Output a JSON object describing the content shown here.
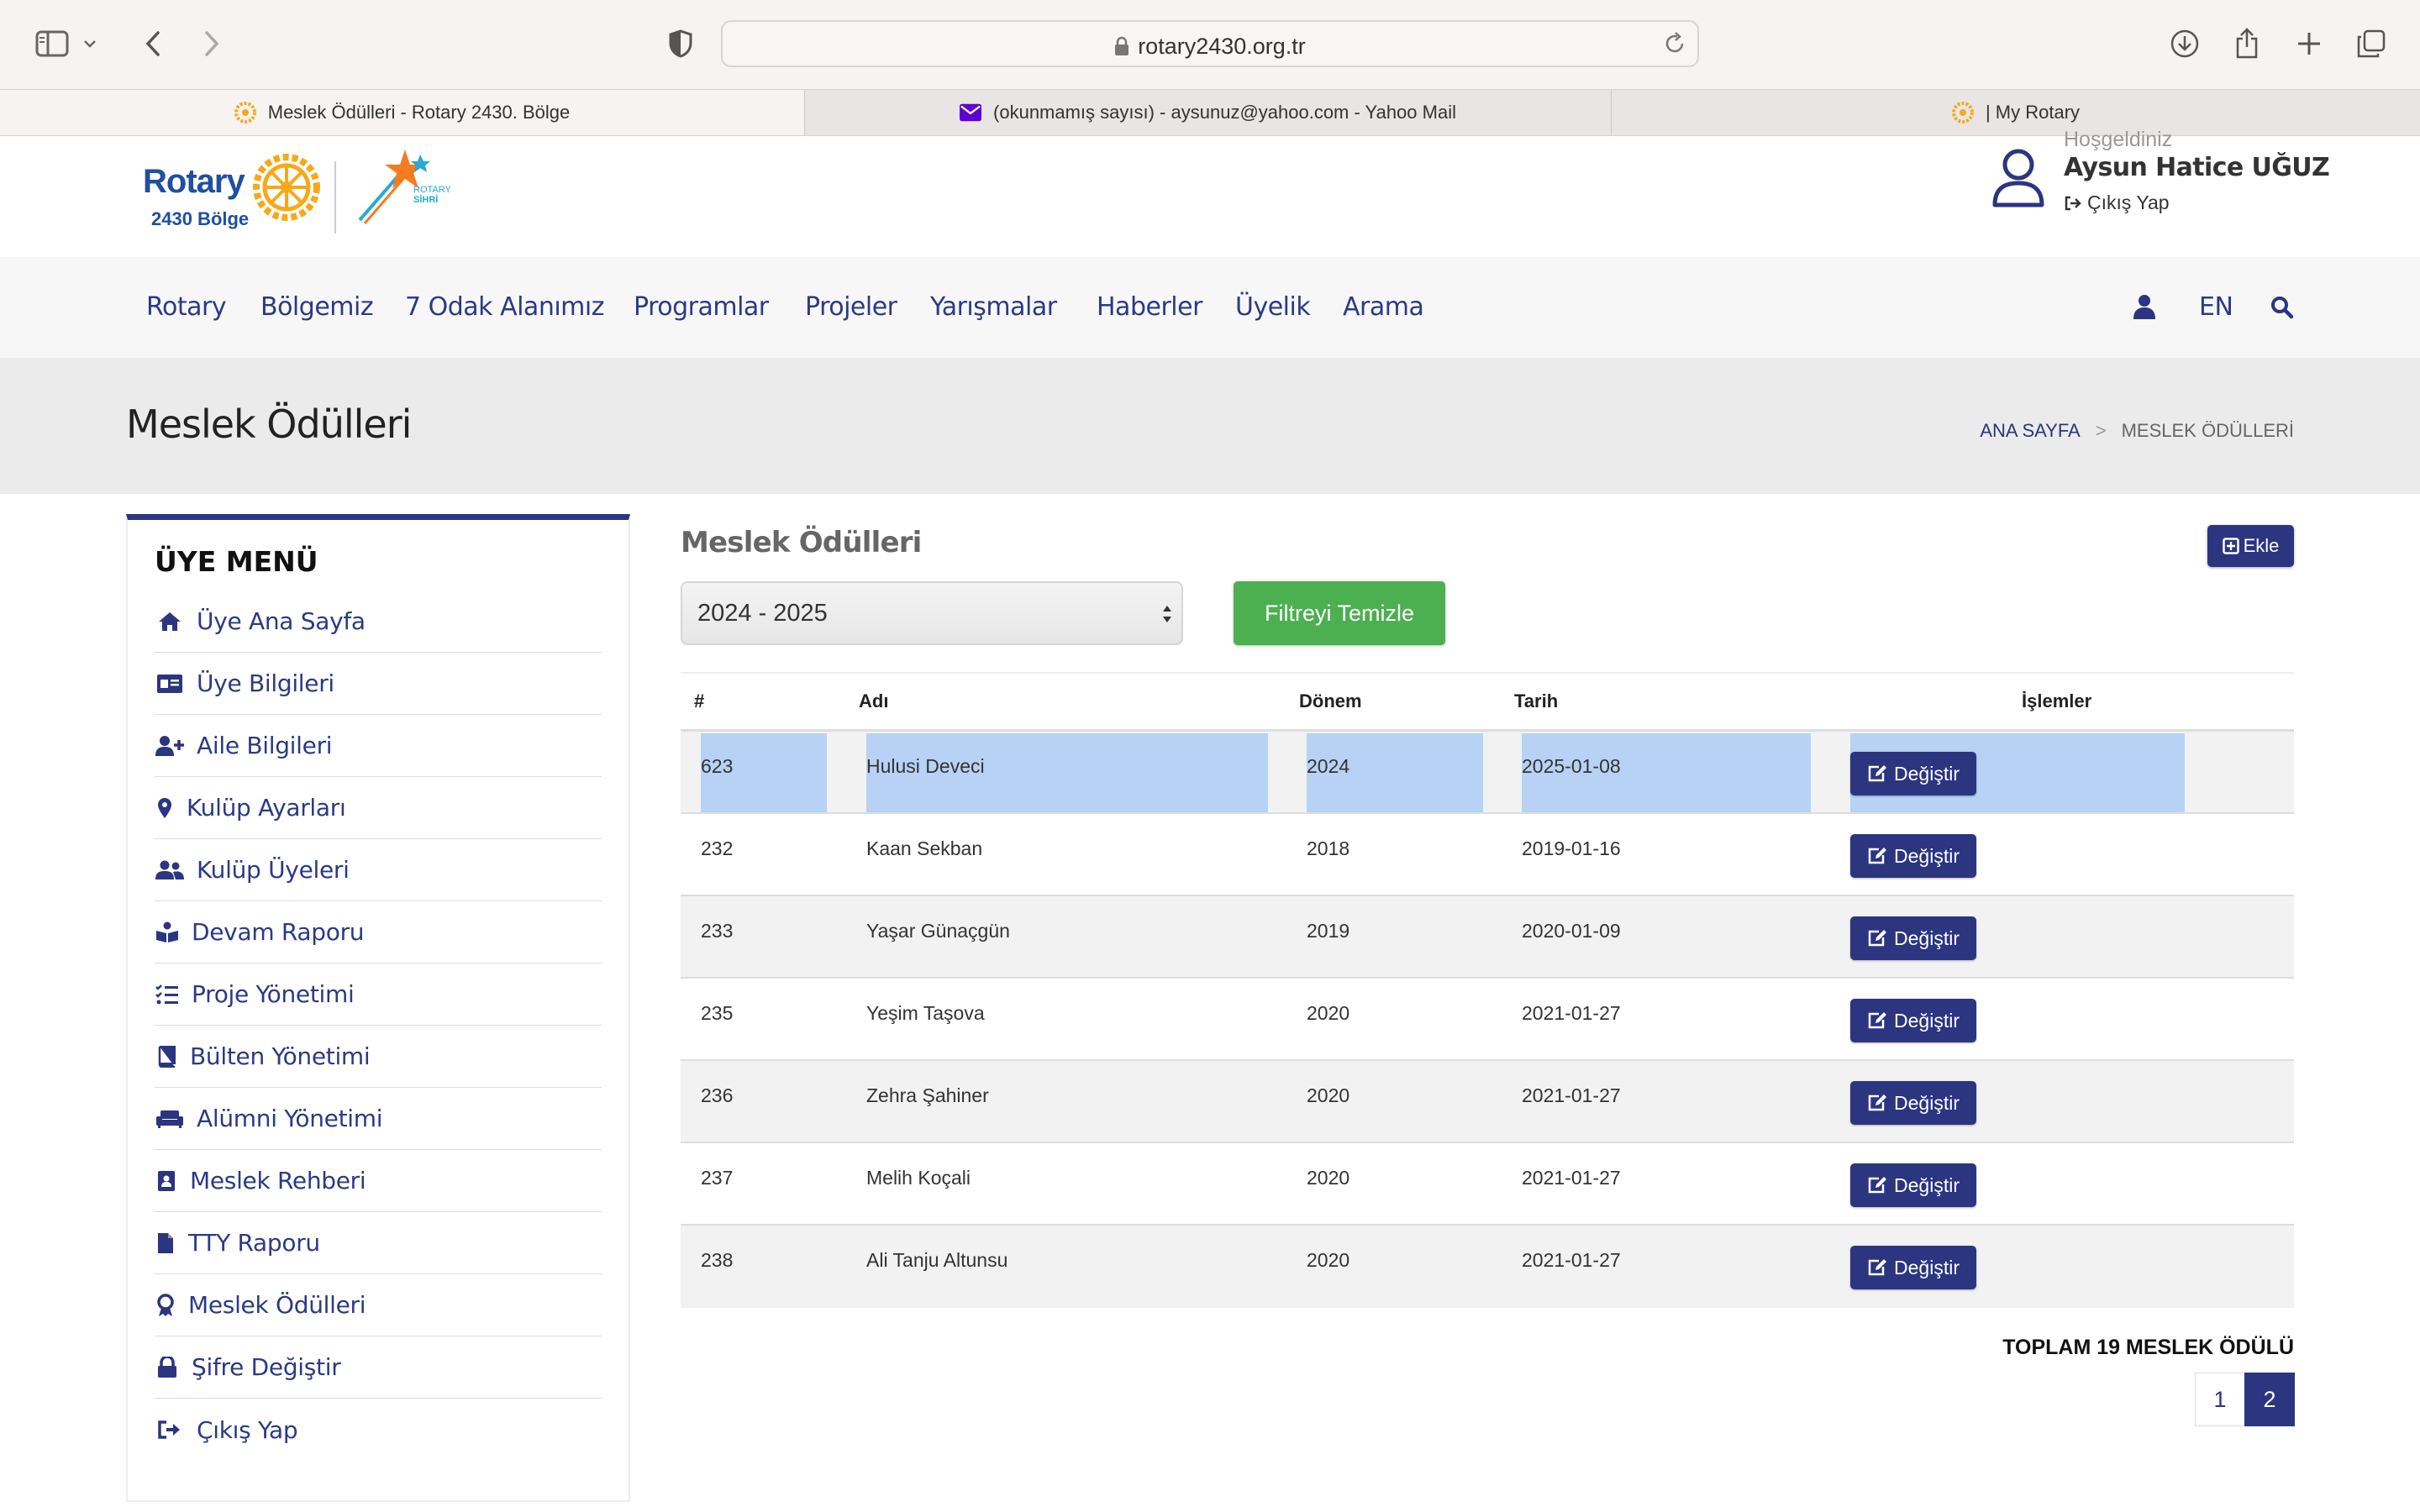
{
  "browser": {
    "url": "rotary2430.org.tr",
    "tabs": [
      {
        "title": "Meslek Ödülleri - Rotary 2430. Bölge",
        "active": true
      },
      {
        "title": "(okunmamış sayısı) - aysunuz@yahoo.com - Yahoo Mail",
        "active": false
      },
      {
        "title": "| My Rotary",
        "active": false
      }
    ]
  },
  "header": {
    "logo_word": "Rotary",
    "logo_sub": "2430 Bölge",
    "sihri_line1": "ROTARY",
    "sihri_line2": "SİHRİ",
    "welcome": "Hoşgeldiniz",
    "user_name": "Aysun Hatice UĞUZ",
    "logout": "Çıkış Yap"
  },
  "nav": {
    "items": [
      "Rotary",
      "Bölgemiz",
      "7 Odak Alanımız",
      "Programlar",
      "Projeler",
      "Yarışmalar",
      "Haberler",
      "Üyelik",
      "Arama"
    ],
    "lang": "EN"
  },
  "page": {
    "title": "Meslek Ödülleri",
    "breadcrumb_home": "ANA SAYFA",
    "breadcrumb_sep": ">",
    "breadcrumb_current": "MESLEK ÖDÜLLERİ"
  },
  "sidebar": {
    "title": "ÜYE MENÜ",
    "items": [
      {
        "label": "Üye Ana Sayfa",
        "icon": "home-icon"
      },
      {
        "label": "Üye Bilgileri",
        "icon": "id-card-icon"
      },
      {
        "label": "Aile Bilgileri",
        "icon": "user-plus-icon"
      },
      {
        "label": "Kulüp Ayarları",
        "icon": "map-marker-icon"
      },
      {
        "label": "Kulüp Üyeleri",
        "icon": "users-icon"
      },
      {
        "label": "Devam Raporu",
        "icon": "book-reader-icon"
      },
      {
        "label": "Proje Yönetimi",
        "icon": "tasks-icon"
      },
      {
        "label": "Bülten Yönetimi",
        "icon": "book-icon"
      },
      {
        "label": "Alümni Yönetimi",
        "icon": "couch-icon"
      },
      {
        "label": "Meslek Rehberi",
        "icon": "address-book-icon"
      },
      {
        "label": "TTY Raporu",
        "icon": "file-icon"
      },
      {
        "label": "Meslek Ödülleri",
        "icon": "award-icon"
      },
      {
        "label": "Şifre Değiştir",
        "icon": "lock-icon"
      },
      {
        "label": "Çıkış Yap",
        "icon": "sign-out-icon"
      }
    ]
  },
  "content": {
    "heading": "Meslek Ödülleri",
    "add_label": "Ekle",
    "period_select": "2024 - 2025",
    "clear_filter": "Filtreyi Temizle",
    "columns": [
      "#",
      "Adı",
      "Dönem",
      "Tarih",
      "İşlemler"
    ],
    "edit_label": "Değiştir",
    "rows": [
      {
        "id": "623",
        "name": "Hulusi Deveci",
        "period": "2024",
        "date": "2025-01-08",
        "selected": true
      },
      {
        "id": "232",
        "name": "Kaan Sekban",
        "period": "2018",
        "date": "2019-01-16",
        "selected": false
      },
      {
        "id": "233",
        "name": "Yaşar Günaçgün",
        "period": "2019",
        "date": "2020-01-09",
        "selected": false
      },
      {
        "id": "235",
        "name": "Yeşim Taşova",
        "period": "2020",
        "date": "2021-01-27",
        "selected": false
      },
      {
        "id": "236",
        "name": "Zehra Şahiner",
        "period": "2020",
        "date": "2021-01-27",
        "selected": false
      },
      {
        "id": "237",
        "name": "Melih Koçali",
        "period": "2020",
        "date": "2021-01-27",
        "selected": false
      },
      {
        "id": "238",
        "name": "Ali Tanju Altunsu",
        "period": "2020",
        "date": "2021-01-27",
        "selected": false
      }
    ],
    "total_label": "TOPLAM 19 MESLEK ÖDÜLÜ",
    "pages": [
      "1",
      "2"
    ],
    "current_page": "2"
  },
  "colors": {
    "brand_navy": "#2b3580",
    "nav_text": "#2b3a85",
    "green": "#4caf50",
    "selection": "#b7d2f4",
    "rotary_gold": "#f7a81b"
  }
}
